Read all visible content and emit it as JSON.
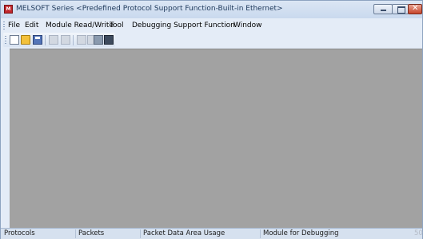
{
  "window": {
    "title": "MELSOFT Series <Predefined Protocol Support Function-Built-in Ethernet>",
    "icon": "melsoft-app-icon"
  },
  "menu": {
    "items": [
      "File",
      "Edit",
      "Module Read/Write",
      "Tool",
      "Debugging Support Function",
      "Window"
    ]
  },
  "toolbar": {
    "buttons": [
      "new-file-icon",
      "open-folder-icon",
      "save-icon",
      "copy-icon",
      "paste-icon",
      "module-read-icon",
      "module-write-icon",
      "connect-icon",
      "disconnect-icon"
    ]
  },
  "statusbar": {
    "protocols": "Protocols",
    "packets": "Packets",
    "packet_data_area_usage": "Packet Data Area Usage",
    "module_for_debugging": "Module for Debugging",
    "trailing": "50"
  },
  "colors": {
    "workspace": "#a2a2a2",
    "chrome": "#dfe9f5",
    "close_button": "#c7442b"
  }
}
